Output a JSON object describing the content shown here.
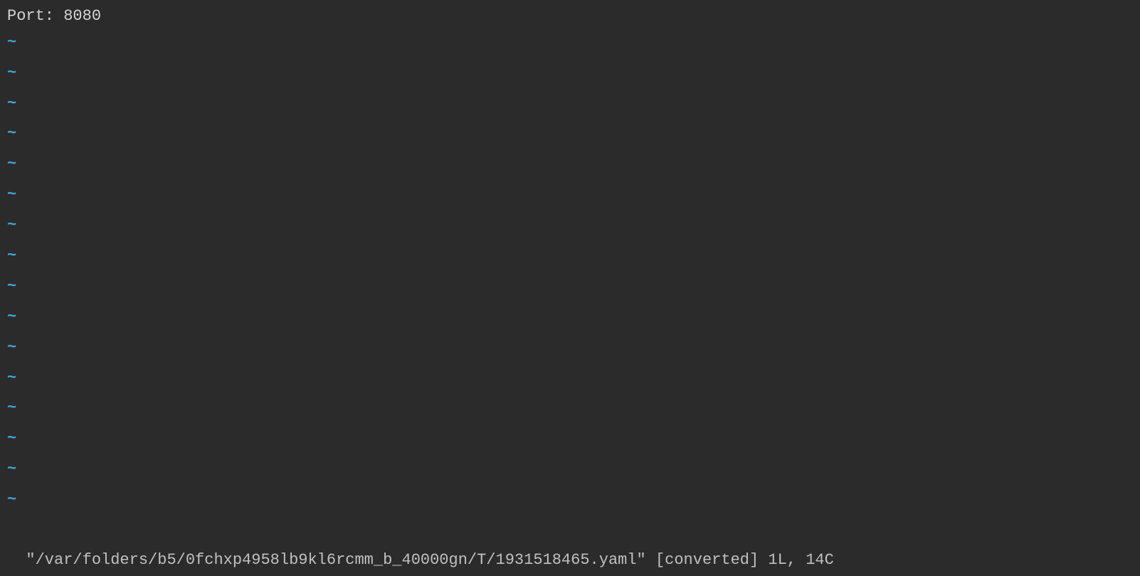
{
  "editor": {
    "content_line": "Port: 8080",
    "tilde_char": "~",
    "empty_line_count": 16
  },
  "status": {
    "file_path": "\"/var/folders/b5/0fchxp4958lb9kl6rcmm_b_40000gn/T/1931518465.yaml\"",
    "flags": "[converted]",
    "position": "1L, 14C"
  }
}
